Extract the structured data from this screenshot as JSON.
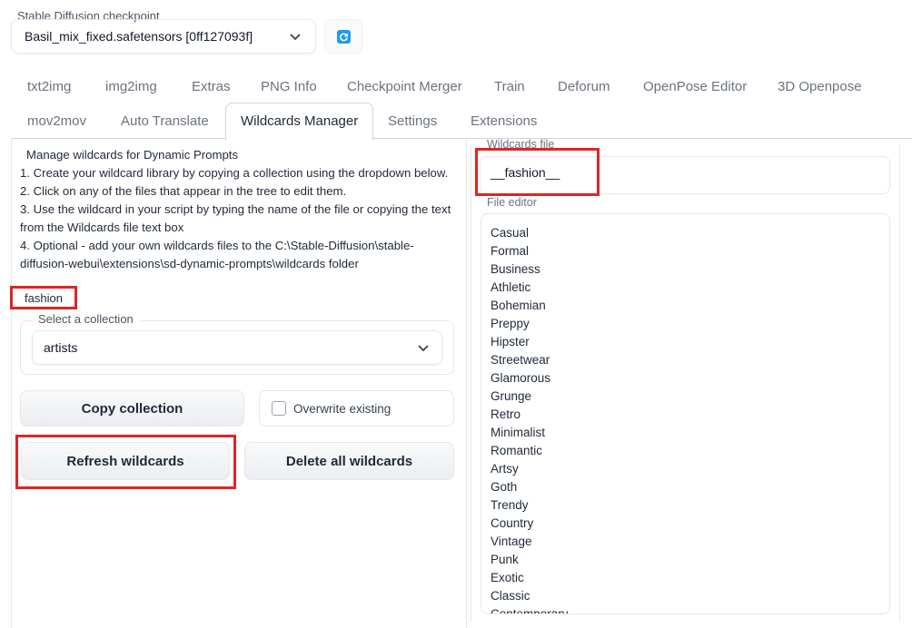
{
  "checkpoint": {
    "label": "Stable Diffusion checkpoint",
    "value": "Basil_mix_fixed.safetensors [0ff127093f]"
  },
  "tabs_row1": [
    "txt2img",
    "img2img",
    "Extras",
    "PNG Info",
    "Checkpoint Merger",
    "Train",
    "Deforum",
    "OpenPose Editor",
    "3D Openpose"
  ],
  "tabs_row2": [
    "mov2mov",
    "Auto Translate",
    "Wildcards Manager",
    "Settings",
    "Extensions"
  ],
  "active_tab": "Wildcards Manager",
  "instructions": {
    "title": "Manage wildcards for Dynamic Prompts",
    "step1": "1. Create your wildcard library by copying a collection using the dropdown below.",
    "step2": "2. Click on any of the files that appear in the tree to edit them.",
    "step3a": "3. Use the wildcard in your script by typing the name of the file or copying the text",
    "step3b": "from the Wildcards file text box",
    "step4a": "4. Optional - add your own wildcards files to the C:\\Stable-Diffusion\\stable-",
    "step4b": "diffusion-webui\\extensions\\sd-dynamic-prompts\\wildcards folder"
  },
  "tree_item": "fashion",
  "collection": {
    "label": "Select a collection",
    "value": "artists"
  },
  "buttons": {
    "copy": "Copy collection",
    "overwrite": "Overwrite existing",
    "refresh": "Refresh wildcards",
    "delete_all": "Delete all wildcards"
  },
  "wildcards_file": {
    "label": "Wildcards file",
    "value": "__fashion__"
  },
  "file_editor": {
    "label": "File editor",
    "lines": [
      "Casual",
      "Formal",
      "Business",
      "Athletic",
      "Bohemian",
      "Preppy",
      "Hipster",
      "Streetwear",
      "Glamorous",
      "Grunge",
      "Retro",
      "Minimalist",
      "Romantic",
      "Artsy",
      "Goth",
      "Trendy",
      "Country",
      "Vintage",
      "Punk",
      "Exotic",
      "Classic",
      "Contemporary"
    ]
  },
  "colors": {
    "highlight": "#e02424",
    "refresh_icon": "#1d9bf0"
  }
}
